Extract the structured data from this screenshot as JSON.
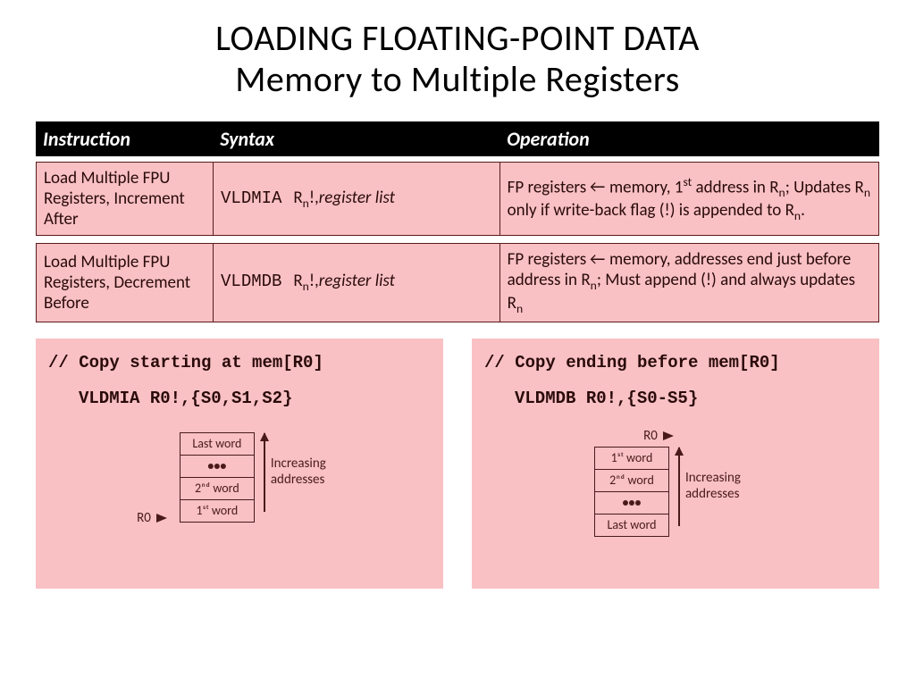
{
  "title_line1": "LOADING FLOATING-POINT DATA",
  "title_line2": "Memory to Multiple Registers",
  "headers": {
    "c1": "Instruction",
    "c2": "Syntax",
    "c3": "Operation"
  },
  "rows": [
    {
      "instruction": "Load Multiple FPU Registers, Increment After",
      "mnemonic": "VLDMIA",
      "syntax_reg": "R",
      "syntax_sub": "n",
      "syntax_bang": "!,",
      "syntax_list": "register list",
      "operation_pre": "FP registers ",
      "operation_arrow": "→",
      "operation_mid1": " memory, 1",
      "operation_sup": "st",
      "operation_mid2": " address in R",
      "operation_sub1": "n",
      "operation_mid3": "; Updates R",
      "operation_sub2": "n",
      "operation_mid4": " only if write-back flag (!) is appended to R",
      "operation_sub3": "n",
      "operation_end": "."
    },
    {
      "instruction": "Load Multiple FPU Registers, Decrement Before",
      "mnemonic": "VLDMDB",
      "syntax_reg": "R",
      "syntax_sub": "n",
      "syntax_bang": "!,",
      "syntax_list": "register list",
      "operation_pre": "FP registers ",
      "operation_arrow": "→",
      "operation_mid1": " memory, addresses end just before address in R",
      "operation_sub1": "n",
      "operation_mid2": "; Must append (!) and always updates R",
      "operation_sub2": "n"
    }
  ],
  "examples": {
    "left": {
      "comment": "// Copy starting at mem[R0]",
      "code": "VLDMIA  R0!,{S0,S1,S2}",
      "r0": "R0",
      "cells": [
        "Last word",
        "•••",
        "2ⁿᵈ word",
        "1ˢᵗ word"
      ],
      "inc": "Increasing addresses"
    },
    "right": {
      "comment": "// Copy ending before mem[R0]",
      "code": "VLDMDB R0!,{S0-S5}",
      "r0": "R0",
      "cells": [
        "1ˢᵗ word",
        "2ⁿᵈ word",
        "•••",
        "Last word"
      ],
      "inc": "Increasing addresses"
    }
  }
}
